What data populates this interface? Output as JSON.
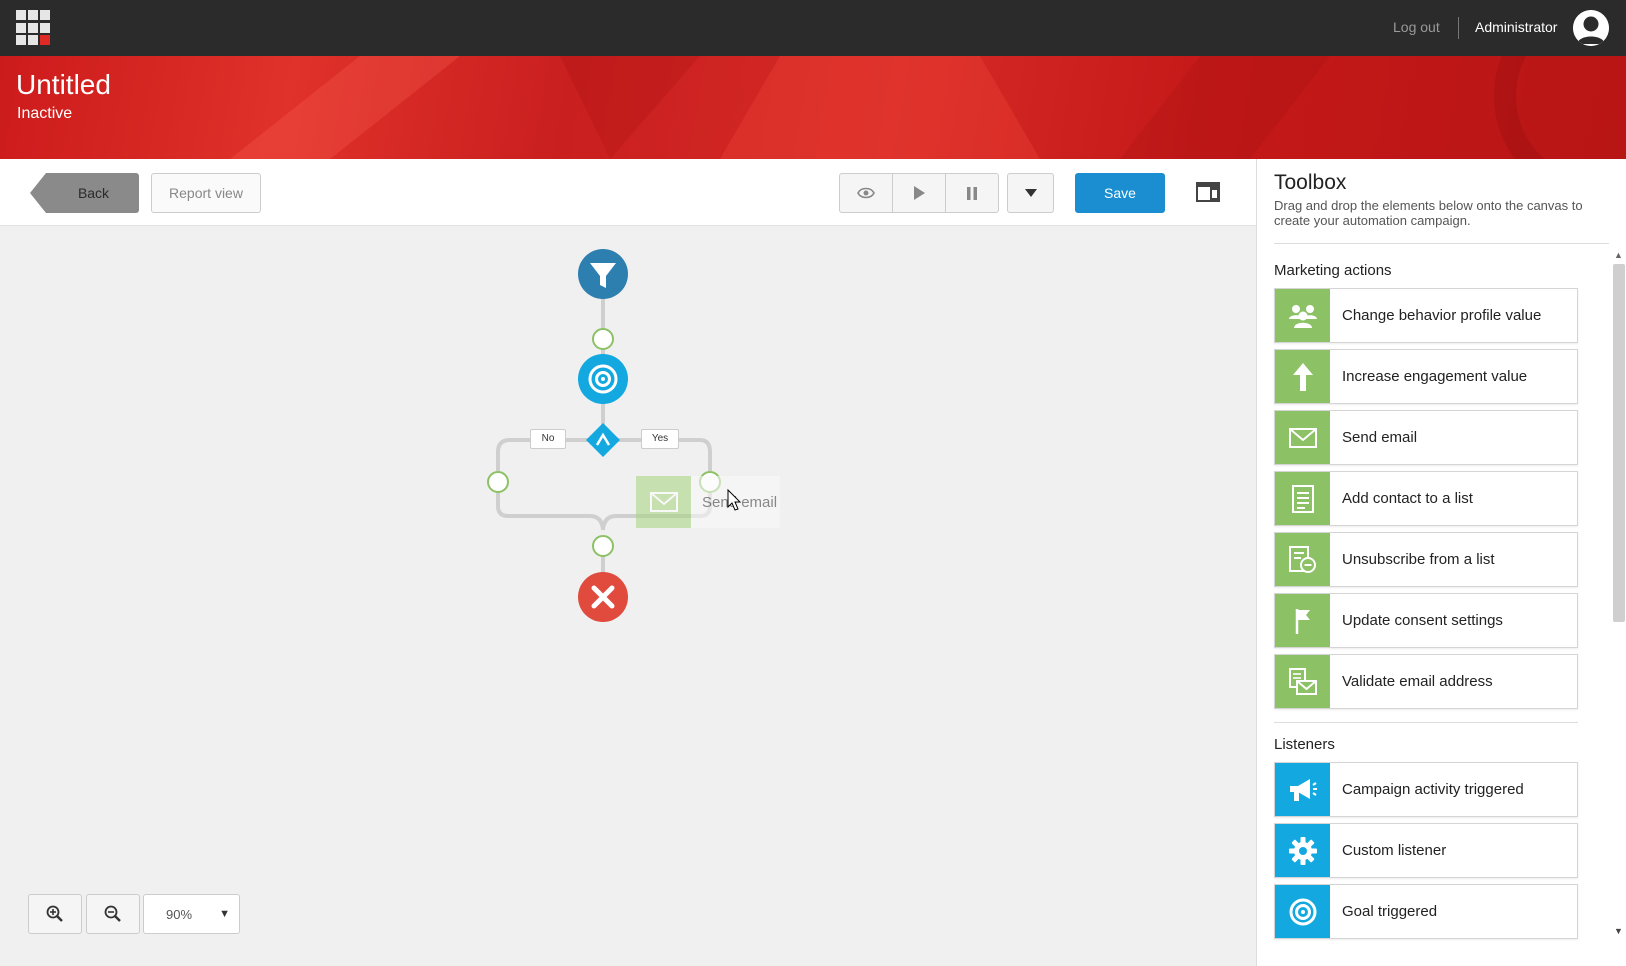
{
  "header": {
    "logout_label": "Log out",
    "user_name": "Administrator"
  },
  "page": {
    "title": "Untitled",
    "status": "Inactive"
  },
  "toolbar": {
    "back_label": "Back",
    "report_view_label": "Report view",
    "save_label": "Save",
    "icons": [
      "eye-icon",
      "play-icon",
      "pause-icon",
      "caret-down-icon",
      "panel-toggle-icon"
    ]
  },
  "canvas": {
    "branch_no_label": "No",
    "branch_yes_label": "Yes",
    "dragged_item_label": "Send email",
    "zoom_value": "90%",
    "colors": {
      "filter_node": "#2d7fb0",
      "goal_node": "#13a9e0",
      "end_node": "#e04b3e",
      "connector": "#8cc265"
    }
  },
  "toolbox": {
    "title": "Toolbox",
    "description": "Drag and drop the elements below onto the canvas to create your automation campaign.",
    "sections": [
      {
        "title": "Marketing actions",
        "items": [
          {
            "label": "Change behavior profile value",
            "icon": "people-icon"
          },
          {
            "label": "Increase engagement value",
            "icon": "arrow-up-icon"
          },
          {
            "label": "Send email",
            "icon": "envelope-icon"
          },
          {
            "label": "Add contact to a list",
            "icon": "list-icon"
          },
          {
            "label": "Unsubscribe from a list",
            "icon": "list-remove-icon"
          },
          {
            "label": "Update consent settings",
            "icon": "flag-icon"
          },
          {
            "label": "Validate email address",
            "icon": "validate-email-icon"
          }
        ]
      },
      {
        "title": "Listeners",
        "items": [
          {
            "label": "Campaign activity triggered",
            "icon": "megaphone-icon"
          },
          {
            "label": "Custom listener",
            "icon": "gear-icon"
          },
          {
            "label": "Goal triggered",
            "icon": "target-icon"
          }
        ]
      }
    ]
  }
}
